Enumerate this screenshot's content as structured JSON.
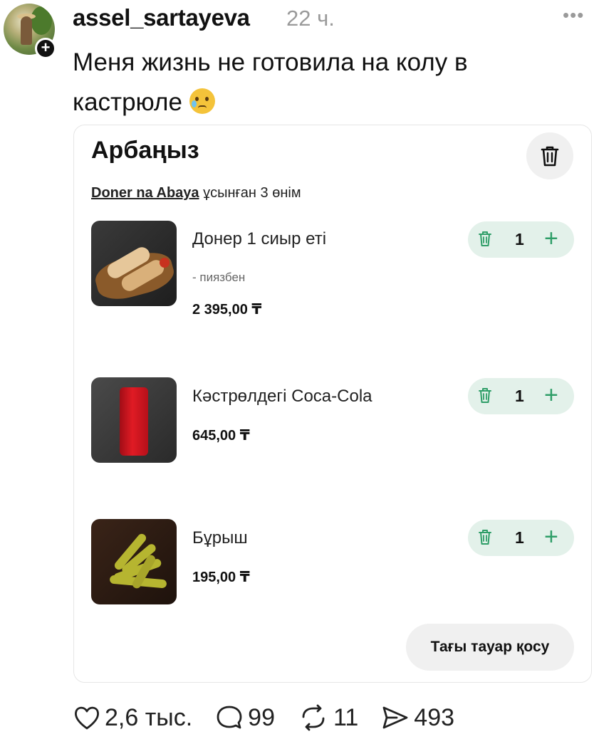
{
  "post": {
    "username": "assel_sartayeva",
    "time": "22 ч.",
    "text": "Меня жизнь не готовила на колу в кастрюле",
    "follow_icon": "plus-icon",
    "more_icon": "more-horizontal-icon"
  },
  "cart": {
    "title": "Арбаңыз",
    "vendor": "Doner na Abaya",
    "subtitle_rest": " ұсынған 3 өнім",
    "items": [
      {
        "name": "Донер 1 сиыр еті",
        "modifier": "- пиязбен",
        "price": "2 395,00 ₸",
        "qty": "1",
        "image": "doner-image"
      },
      {
        "name": "Кәстрөлдегі Coca-Cola",
        "price": "645,00 ₸",
        "qty": "1",
        "image": "coca-cola-can-image"
      },
      {
        "name": "Бұрыш",
        "price": "195,00 ₸",
        "qty": "1",
        "image": "pickled-peppers-image"
      }
    ],
    "plus_symbol": "+",
    "add_more_label": "Тағы тауар қосу"
  },
  "actions": {
    "likes": "2,6 тыс.",
    "comments": "99",
    "reposts": "11",
    "shares": "493"
  },
  "colors": {
    "accent_green": "#2f9e68",
    "qty_bg": "#e3f1ea",
    "muted_gray": "#9a9a9a"
  }
}
